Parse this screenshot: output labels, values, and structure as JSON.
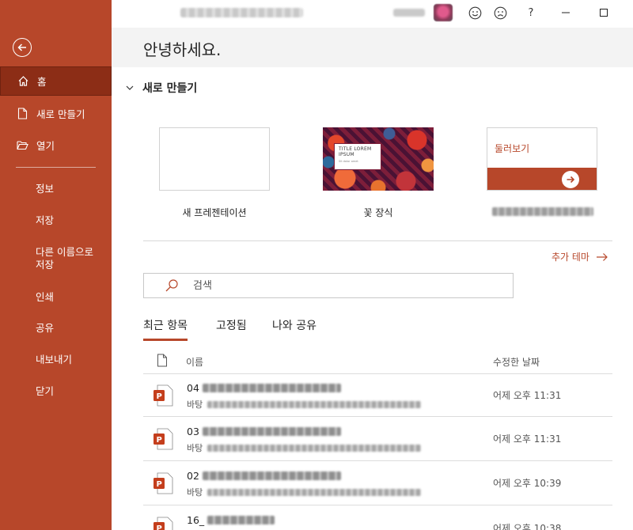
{
  "sidebar": {
    "nav": [
      {
        "label": "홈"
      },
      {
        "label": "새로 만들기"
      },
      {
        "label": "열기"
      }
    ],
    "items": [
      {
        "label": "정보"
      },
      {
        "label": "저장"
      },
      {
        "label": "다른 이름으로 저장"
      },
      {
        "label": "인쇄"
      },
      {
        "label": "공유"
      },
      {
        "label": "내보내기"
      },
      {
        "label": "닫기"
      }
    ]
  },
  "topbar": {
    "feedback_icons": [
      "smiley-happy-icon",
      "smiley-sad-icon"
    ],
    "help": "?"
  },
  "main": {
    "greeting": "안녕하세요.",
    "new_section_title": "새로 만들기",
    "templates": [
      {
        "label": "새 프레젠테이션"
      },
      {
        "label": "꽃 장식",
        "thumb_title": "TITLE LOREM IPSUM",
        "thumb_sub": "Sit dolor amet"
      },
      {
        "thumb_title": "둘러보기"
      }
    ],
    "more_themes": "추가 테마",
    "search_placeholder": "검색",
    "tabs": [
      {
        "label": "최근 항목"
      },
      {
        "label": "고정됨"
      },
      {
        "label": "나와 공유"
      }
    ],
    "columns": {
      "name": "이름",
      "modified": "수정한 날짜"
    },
    "files": [
      {
        "prefix": "04",
        "location_prefix": "바탕",
        "date": "어제 오후 11:31"
      },
      {
        "prefix": "03",
        "location_prefix": "바탕",
        "date": "어제 오후 11:31"
      },
      {
        "prefix": "02",
        "location_prefix": "바탕",
        "date": "어제 오후 10:39"
      },
      {
        "prefix": "16_",
        "date": "어제 오후 10:38"
      }
    ]
  },
  "colors": {
    "accent": "#b7472a",
    "accent_dark": "#8c2d16",
    "header_band": "#f3f3f3"
  }
}
